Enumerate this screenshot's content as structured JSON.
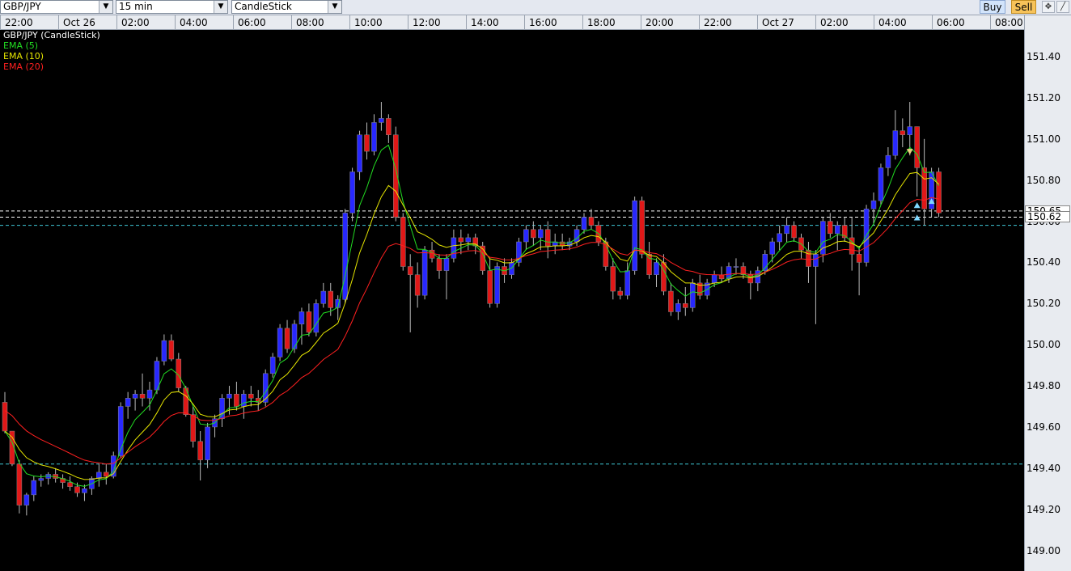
{
  "toolbar": {
    "symbol": "GBP/JPY",
    "timeframe": "15 min",
    "chart_type": "CandleStick",
    "buy_label": "Buy",
    "sell_label": "Sell"
  },
  "legend": [
    {
      "label": "GBP/JPY (CandleStick)",
      "color": "#ffffff"
    },
    {
      "label": "EMA (5)",
      "color": "#22dd22"
    },
    {
      "label": "EMA (10)",
      "color": "#e6e600"
    },
    {
      "label": "EMA (20)",
      "color": "#ff2020"
    }
  ],
  "time_labels": [
    "22:00",
    "Oct 26",
    "02:00",
    "04:00",
    "06:00",
    "08:00",
    "10:00",
    "12:00",
    "14:00",
    "16:00",
    "18:00",
    "20:00",
    "22:00",
    "Oct 27",
    "02:00",
    "04:00",
    "06:00",
    "08:00"
  ],
  "price_labels": [
    "151.40",
    "151.20",
    "151.00",
    "150.80",
    "150.60",
    "150.40",
    "150.20",
    "150.00",
    "149.80",
    "149.60",
    "149.40",
    "149.20",
    "149.00"
  ],
  "marker_prices": [
    "150.65",
    "150.62"
  ],
  "colors": {
    "bull": "#2828ff",
    "bear": "#e01818",
    "ema5": "#22dd22",
    "ema10": "#e6e600",
    "ema20": "#ff2020",
    "hline": "#ffffff",
    "cyan_line": "#3fc7d6"
  },
  "chart_data": {
    "type": "candlestick",
    "symbol": "GBP/JPY",
    "interval": "15 min",
    "ylim": [
      148.9,
      151.53
    ],
    "candles": [
      [
        149.72,
        149.77,
        149.57,
        149.58
      ],
      [
        149.58,
        149.58,
        149.41,
        149.42
      ],
      [
        149.42,
        149.44,
        149.18,
        149.22
      ],
      [
        149.22,
        149.28,
        149.17,
        149.27
      ],
      [
        149.27,
        149.36,
        149.24,
        149.34
      ],
      [
        149.34,
        149.37,
        149.31,
        149.35
      ],
      [
        149.35,
        149.38,
        149.32,
        149.37
      ],
      [
        149.37,
        149.4,
        149.33,
        149.35
      ],
      [
        149.35,
        149.37,
        149.3,
        149.33
      ],
      [
        149.33,
        149.36,
        149.29,
        149.31
      ],
      [
        149.31,
        149.33,
        149.26,
        149.28
      ],
      [
        149.28,
        149.32,
        149.24,
        149.3
      ],
      [
        149.3,
        149.36,
        149.27,
        149.35
      ],
      [
        149.35,
        149.42,
        149.31,
        149.38
      ],
      [
        149.38,
        149.42,
        149.32,
        149.36
      ],
      [
        149.36,
        149.48,
        149.35,
        149.46
      ],
      [
        149.46,
        149.72,
        149.45,
        149.7
      ],
      [
        149.7,
        149.77,
        149.64,
        149.74
      ],
      [
        149.74,
        149.78,
        149.68,
        149.76
      ],
      [
        149.76,
        149.86,
        149.7,
        149.74
      ],
      [
        149.74,
        149.82,
        149.68,
        149.78
      ],
      [
        149.78,
        149.94,
        149.76,
        149.92
      ],
      [
        149.92,
        150.05,
        149.9,
        150.02
      ],
      [
        150.02,
        150.05,
        149.92,
        149.93
      ],
      [
        149.93,
        149.96,
        149.77,
        149.79
      ],
      [
        149.79,
        149.8,
        149.65,
        149.66
      ],
      [
        149.66,
        149.7,
        149.5,
        149.53
      ],
      [
        149.53,
        149.58,
        149.34,
        149.44
      ],
      [
        149.44,
        149.62,
        149.4,
        149.6
      ],
      [
        149.6,
        149.66,
        149.55,
        149.64
      ],
      [
        149.64,
        149.76,
        149.6,
        149.74
      ],
      [
        149.74,
        149.8,
        149.66,
        149.76
      ],
      [
        149.76,
        149.82,
        149.68,
        149.7
      ],
      [
        149.7,
        149.78,
        149.64,
        149.76
      ],
      [
        149.76,
        149.8,
        149.7,
        149.74
      ],
      [
        149.74,
        149.78,
        149.68,
        149.72
      ],
      [
        149.72,
        149.88,
        149.7,
        149.86
      ],
      [
        149.86,
        149.96,
        149.84,
        149.94
      ],
      [
        149.94,
        150.1,
        149.92,
        150.08
      ],
      [
        150.08,
        150.12,
        149.96,
        149.98
      ],
      [
        149.98,
        150.12,
        149.96,
        150.1
      ],
      [
        150.1,
        150.18,
        150.0,
        150.16
      ],
      [
        150.16,
        150.2,
        150.04,
        150.06
      ],
      [
        150.06,
        150.22,
        150.04,
        150.2
      ],
      [
        150.2,
        150.3,
        150.18,
        150.26
      ],
      [
        150.26,
        150.3,
        150.14,
        150.18
      ],
      [
        150.18,
        150.24,
        150.12,
        150.22
      ],
      [
        150.22,
        150.66,
        150.2,
        150.64
      ],
      [
        150.64,
        150.86,
        150.6,
        150.84
      ],
      [
        150.84,
        151.04,
        150.8,
        151.02
      ],
      [
        151.02,
        151.08,
        150.9,
        150.94
      ],
      [
        150.94,
        151.12,
        150.92,
        151.08
      ],
      [
        151.08,
        151.18,
        151.04,
        151.1
      ],
      [
        151.1,
        151.12,
        150.98,
        151.02
      ],
      [
        151.02,
        151.06,
        150.6,
        150.62
      ],
      [
        150.62,
        150.64,
        150.36,
        150.38
      ],
      [
        150.38,
        150.44,
        150.06,
        150.34
      ],
      [
        150.34,
        150.4,
        150.18,
        150.24
      ],
      [
        150.24,
        150.48,
        150.22,
        150.46
      ],
      [
        150.46,
        150.5,
        150.4,
        150.42
      ],
      [
        150.42,
        150.44,
        150.32,
        150.36
      ],
      [
        150.36,
        150.44,
        150.22,
        150.42
      ],
      [
        150.42,
        150.56,
        150.4,
        150.52
      ],
      [
        150.52,
        150.56,
        150.44,
        150.5
      ],
      [
        150.5,
        150.54,
        150.46,
        150.52
      ],
      [
        150.52,
        150.54,
        150.44,
        150.48
      ],
      [
        150.48,
        150.5,
        150.34,
        150.36
      ],
      [
        150.36,
        150.42,
        150.18,
        150.2
      ],
      [
        150.2,
        150.4,
        150.18,
        150.38
      ],
      [
        150.38,
        150.42,
        150.3,
        150.34
      ],
      [
        150.34,
        150.42,
        150.32,
        150.4
      ],
      [
        150.4,
        150.52,
        150.38,
        150.5
      ],
      [
        150.5,
        150.58,
        150.46,
        150.56
      ],
      [
        150.56,
        150.6,
        150.48,
        150.52
      ],
      [
        150.52,
        150.58,
        150.46,
        150.56
      ],
      [
        150.56,
        150.6,
        150.42,
        150.48
      ],
      [
        150.48,
        150.54,
        150.44,
        150.5
      ],
      [
        150.5,
        150.54,
        150.46,
        150.48
      ],
      [
        150.48,
        150.52,
        150.46,
        150.5
      ],
      [
        150.5,
        150.58,
        150.48,
        150.56
      ],
      [
        150.56,
        150.64,
        150.54,
        150.62
      ],
      [
        150.62,
        150.66,
        150.56,
        150.58
      ],
      [
        150.58,
        150.6,
        150.48,
        150.5
      ],
      [
        150.5,
        150.52,
        150.36,
        150.38
      ],
      [
        150.38,
        150.42,
        150.22,
        150.26
      ],
      [
        150.26,
        150.28,
        150.22,
        150.24
      ],
      [
        150.24,
        150.4,
        150.22,
        150.36
      ],
      [
        150.36,
        150.72,
        150.34,
        150.7
      ],
      [
        150.7,
        150.72,
        150.42,
        150.44
      ],
      [
        150.44,
        150.5,
        150.32,
        150.34
      ],
      [
        150.34,
        150.42,
        150.28,
        150.4
      ],
      [
        150.4,
        150.44,
        150.24,
        150.26
      ],
      [
        150.26,
        150.3,
        150.14,
        150.16
      ],
      [
        150.16,
        150.22,
        150.12,
        150.2
      ],
      [
        150.2,
        150.28,
        150.14,
        150.18
      ],
      [
        150.18,
        150.32,
        150.16,
        150.3
      ],
      [
        150.3,
        150.34,
        150.22,
        150.24
      ],
      [
        150.24,
        150.32,
        150.22,
        150.3
      ],
      [
        150.3,
        150.36,
        150.28,
        150.34
      ],
      [
        150.34,
        150.38,
        150.3,
        150.32
      ],
      [
        150.32,
        150.4,
        150.3,
        150.38
      ],
      [
        150.38,
        150.42,
        150.34,
        150.38
      ],
      [
        150.38,
        150.4,
        150.32,
        150.34
      ],
      [
        150.34,
        150.36,
        150.22,
        150.3
      ],
      [
        150.3,
        150.38,
        150.26,
        150.36
      ],
      [
        150.36,
        150.46,
        150.34,
        150.44
      ],
      [
        150.44,
        150.52,
        150.4,
        150.5
      ],
      [
        150.5,
        150.58,
        150.46,
        150.54
      ],
      [
        150.54,
        150.62,
        150.5,
        150.58
      ],
      [
        150.58,
        150.6,
        150.5,
        150.52
      ],
      [
        150.52,
        150.54,
        150.42,
        150.46
      ],
      [
        150.46,
        150.5,
        150.3,
        150.38
      ],
      [
        150.38,
        150.46,
        150.1,
        150.44
      ],
      [
        150.44,
        150.62,
        150.4,
        150.6
      ],
      [
        150.6,
        150.64,
        150.52,
        150.54
      ],
      [
        150.54,
        150.6,
        150.46,
        150.58
      ],
      [
        150.58,
        150.62,
        150.5,
        150.52
      ],
      [
        150.52,
        150.62,
        150.36,
        150.44
      ],
      [
        150.44,
        150.48,
        150.24,
        150.4
      ],
      [
        150.4,
        150.68,
        150.38,
        150.66
      ],
      [
        150.66,
        150.74,
        150.58,
        150.7
      ],
      [
        150.7,
        150.88,
        150.68,
        150.86
      ],
      [
        150.86,
        150.96,
        150.82,
        150.92
      ],
      [
        150.92,
        151.14,
        150.9,
        151.04
      ],
      [
        151.04,
        151.1,
        150.96,
        151.02
      ],
      [
        151.02,
        151.18,
        150.92,
        151.06
      ],
      [
        151.06,
        151.06,
        150.72,
        150.86
      ],
      [
        150.86,
        151.0,
        150.58,
        150.66
      ],
      [
        150.66,
        150.86,
        150.62,
        150.84
      ],
      [
        150.84,
        150.86,
        150.62,
        150.64
      ]
    ],
    "ema": [
      {
        "name": "EMA (5)",
        "period": 5
      },
      {
        "name": "EMA (10)",
        "period": 10
      },
      {
        "name": "EMA (20)",
        "period": 20
      }
    ]
  }
}
